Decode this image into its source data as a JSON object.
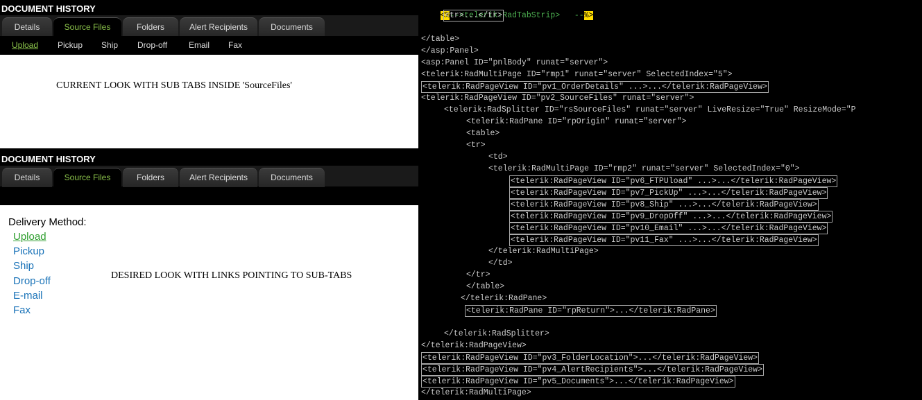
{
  "top_panel": {
    "header": "DOCUMENT HISTORY",
    "tabs": [
      "Details",
      "Source Files",
      "Folders",
      "Alert Recipients",
      "Documents"
    ],
    "selected_tab": "Source Files",
    "subtabs": [
      "Upload",
      "Pickup",
      "Ship",
      "Drop-off",
      "Email",
      "Fax"
    ],
    "selected_subtab": "Upload",
    "note": "CURRENT LOOK WITH SUB TABS INSIDE 'SourceFiles'"
  },
  "bottom_panel": {
    "header": "DOCUMENT HISTORY",
    "tabs": [
      "Details",
      "Source Files",
      "Folders",
      "Alert Recipients",
      "Documents"
    ],
    "selected_tab": "Source Files",
    "delivery_label": "Delivery Method:",
    "links": [
      "Upload",
      "Pickup",
      "Ship",
      "Drop-off",
      "E-mail",
      "Fax"
    ],
    "note": "DESIRED LOOK WITH LINKS POINTING TO SUB-TABS"
  },
  "code": {
    "l0_a": "<%",
    "l0_b": "--<telerik:RadTabStrip>   --",
    "l0_c": "%>",
    "l1": "<tr>...</tr>",
    "l2": "</table>",
    "l3": "</asp:Panel>",
    "l4": "<asp:Panel ID=\"pnlBody\" runat=\"server\">",
    "l5": "<telerik:RadMultiPage ID=\"rmp1\" runat=\"server\" SelectedIndex=\"5\">",
    "l6": "<telerik:RadPageView ID=\"pv1_OrderDetails\" ...>...</telerik:RadPageView>",
    "l7": "<telerik:RadPageView ID=\"pv2_SourceFiles\" runat=\"server\">",
    "l8": "<telerik:RadSplitter ID=\"rsSourceFiles\" runat=\"server\" LiveResize=\"True\" ResizeMode=\"P",
    "l9": "<telerik:RadPane ID=\"rpOrigin\" runat=\"server\">",
    "l10": "<table>",
    "l11": "<tr>",
    "l12": "<td>",
    "l13": "<telerik:RadMultiPage ID=\"rmp2\" runat=\"server\" SelectedIndex=\"0\">",
    "l14": "<telerik:RadPageView ID=\"pv6_FTPUload\" ...>...</telerik:RadPageView>",
    "l15": "<telerik:RadPageView ID=\"pv7_PickUp\" ...>...</telerik:RadPageView>",
    "l16": "<telerik:RadPageView ID=\"pv8_Ship\" ...>...</telerik:RadPageView>",
    "l17": "<telerik:RadPageView ID=\"pv9_DropOff\" ...>...</telerik:RadPageView>",
    "l18": "<telerik:RadPageView ID=\"pv10_Email\" ...>...</telerik:RadPageView>",
    "l19": "<telerik:RadPageView ID=\"pv11_Fax\" ...>...</telerik:RadPageView>",
    "l20": "</telerik:RadMultiPage>",
    "l21": "</td>",
    "l22": "</tr>",
    "l23": "</table>",
    "l24": "</telerik:RadPane>",
    "l25": "<telerik:RadPane ID=\"rpReturn\">...</telerik:RadPane>",
    "l26": "</telerik:RadSplitter>",
    "l27": "</telerik:RadPageView>",
    "l28": "<telerik:RadPageView ID=\"pv3_FolderLocation\">...</telerik:RadPageView>",
    "l29": "<telerik:RadPageView ID=\"pv4_AlertRecipients\">...</telerik:RadPageView>",
    "l30": "<telerik:RadPageView ID=\"pv5_Documents\">...</telerik:RadPageView>",
    "l31": "</telerik:RadMultiPage>"
  }
}
